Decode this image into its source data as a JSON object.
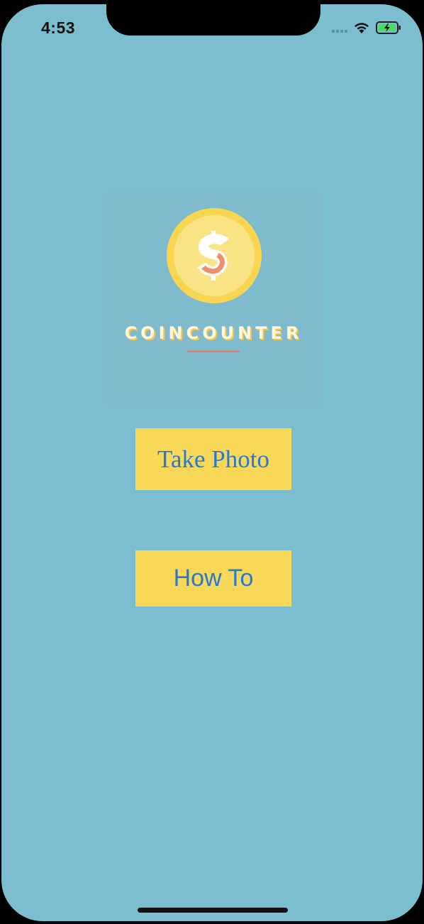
{
  "status_bar": {
    "time": "4:53",
    "icons": [
      "cellular-signal-icon",
      "wifi-icon",
      "battery-charging-icon"
    ]
  },
  "logo": {
    "text": "COINCOUNTER",
    "coin_symbol": "$"
  },
  "buttons": {
    "take_photo": "Take Photo",
    "how_to": "How To"
  },
  "colors": {
    "background": "#7dbdd0",
    "coin_outer": "#f9d651",
    "coin_inner": "#fbe485",
    "button_bg": "#f7d858",
    "button_text": "#2a78d6",
    "accent_underline": "#e97a5e"
  }
}
